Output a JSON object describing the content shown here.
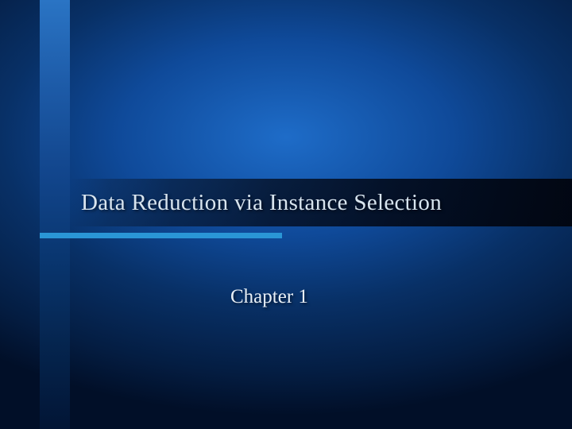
{
  "slide": {
    "title": "Data Reduction via Instance Selection",
    "subtitle": "Chapter 1"
  }
}
